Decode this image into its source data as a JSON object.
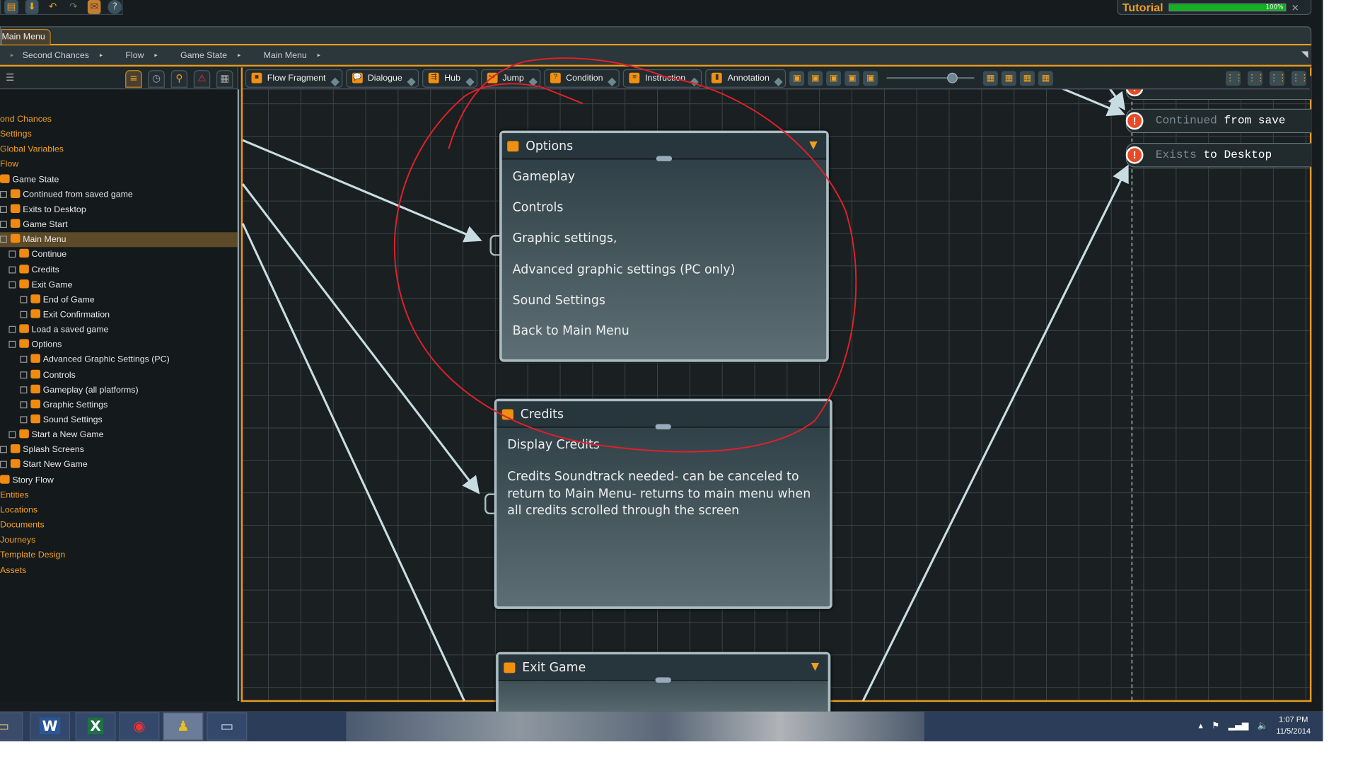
{
  "quick_access": {
    "icons": [
      "document-icon",
      "save-icon",
      "undo-icon",
      "redo-icon",
      "mail-icon",
      "help-icon"
    ]
  },
  "tutorial": {
    "label": "Tutorial",
    "progress_percent": 100,
    "progress_text": "100%",
    "close": "×",
    "bar_color": "#12b023"
  },
  "tab": {
    "label": "Main Menu"
  },
  "breadcrumb": [
    "Second Chances",
    "Flow",
    "Game State",
    "Main Menu"
  ],
  "node_toolbar": {
    "buttons": [
      "Flow Fragment",
      "Dialogue",
      "Hub",
      "Jump",
      "Condition",
      "Instruction",
      "Annotation"
    ],
    "zoom_level": 0.75
  },
  "tree": {
    "items": [
      {
        "label": "ond Chances",
        "level": 0,
        "type": "root"
      },
      {
        "label": "Settings",
        "level": 0,
        "type": "cat"
      },
      {
        "label": "Global Variables",
        "level": 0,
        "type": "cat"
      },
      {
        "label": "Flow",
        "level": 0,
        "type": "cat"
      },
      {
        "label": "Game State",
        "level": 1
      },
      {
        "label": "Continued from saved game",
        "level": 2
      },
      {
        "label": "Exits to Desktop",
        "level": 2
      },
      {
        "label": "Game Start",
        "level": 2
      },
      {
        "label": "Main Menu",
        "level": 2,
        "selected": true
      },
      {
        "label": "Continue",
        "level": 3
      },
      {
        "label": "Credits",
        "level": 3
      },
      {
        "label": "Exit Game",
        "level": 3
      },
      {
        "label": "End of Game",
        "level": 4
      },
      {
        "label": "Exit Confirmation",
        "level": 4
      },
      {
        "label": "Load a saved game",
        "level": 3
      },
      {
        "label": "Options",
        "level": 3
      },
      {
        "label": "Advanced Graphic Settings (PC)",
        "level": 4
      },
      {
        "label": "Controls",
        "level": 4
      },
      {
        "label": "Gameplay (all platforms)",
        "level": 4
      },
      {
        "label": "Graphic Settings",
        "level": 4
      },
      {
        "label": "Sound Settings",
        "level": 4
      },
      {
        "label": "Start a New Game",
        "level": 3
      },
      {
        "label": "Splash Screens",
        "level": 2
      },
      {
        "label": "Start New Game",
        "level": 2
      },
      {
        "label": "Story Flow",
        "level": 1
      },
      {
        "label": "Entities",
        "level": 0,
        "type": "cat"
      },
      {
        "label": "Locations",
        "level": 0,
        "type": "cat"
      },
      {
        "label": "Documents",
        "level": 0,
        "type": "cat"
      },
      {
        "label": "Journeys",
        "level": 0,
        "type": "cat"
      },
      {
        "label": "Template Design",
        "level": 0,
        "type": "cat"
      },
      {
        "label": "Assets",
        "level": 0,
        "type": "cat"
      }
    ]
  },
  "nodes": {
    "options": {
      "title": "Options",
      "items": [
        "Gameplay",
        "Controls",
        "Graphic settings,",
        "Advanced graphic settings (PC only)",
        "Sound Settings",
        "Back to Main Menu"
      ]
    },
    "credits": {
      "title": "Credits",
      "line1": "Display Credits",
      "line2": "Credits Soundtrack needed- can be canceled to return to Main Menu- returns to main menu when all credits scrolled through the screen"
    },
    "exit_game": {
      "title": "Exit Game"
    }
  },
  "outputs": [
    {
      "dim": "Continued",
      "rest": " from save"
    },
    {
      "dim": "Exists",
      "rest": " to Desktop"
    }
  ],
  "annotation_color": "#e0202a",
  "taskbar": {
    "apps": [
      "file-explorer",
      "word",
      "excel",
      "chrome",
      "articy",
      "photos"
    ],
    "time": "1:07 PM",
    "date": "11/5/2014"
  }
}
